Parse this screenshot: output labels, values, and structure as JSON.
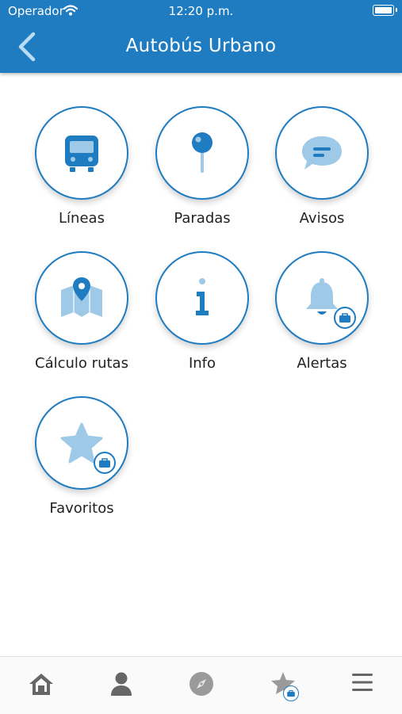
{
  "status_bar": {
    "carrier": "Operador",
    "time": "12:20 p.m."
  },
  "header": {
    "title": "Autobús Urbano"
  },
  "menu": {
    "items": [
      {
        "label": "Líneas",
        "icon": "bus-icon",
        "locked": false
      },
      {
        "label": "Paradas",
        "icon": "pin-icon",
        "locked": false
      },
      {
        "label": "Avisos",
        "icon": "chat-bubble-icon",
        "locked": false
      },
      {
        "label": "Cálculo rutas",
        "icon": "map-route-icon",
        "locked": false
      },
      {
        "label": "Info",
        "icon": "info-icon",
        "locked": false
      },
      {
        "label": "Alertas",
        "icon": "bell-icon",
        "locked": true
      },
      {
        "label": "Favoritos",
        "icon": "star-icon",
        "locked": true
      }
    ]
  },
  "tab_bar": {
    "tabs": [
      "home-icon",
      "user-icon",
      "compass-icon",
      "star-icon",
      "menu-icon"
    ],
    "active": "home-icon"
  },
  "colors": {
    "primary": "#1f7cc1",
    "icon_light": "#9ecae8",
    "icon_dark": "#1f7cc1",
    "tab_icon": "#666666"
  }
}
